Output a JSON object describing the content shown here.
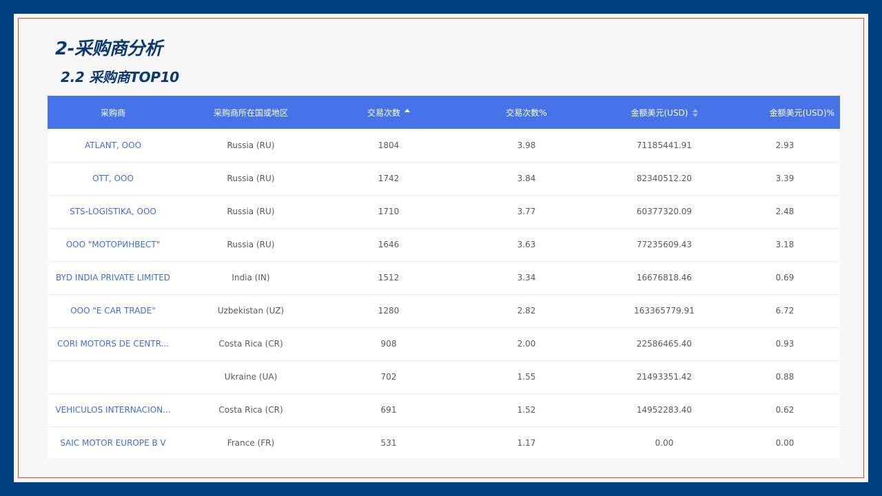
{
  "page": {
    "title": "2-采购商分析",
    "subtitle": "2.2 采购商TOP10"
  },
  "table": {
    "headers": [
      "采购商",
      "采购商所在国或地区",
      "交易次数",
      "交易次数%",
      "金额美元(USD)",
      "金额美元(USD)%"
    ],
    "rows": [
      [
        "ATLANT, OOO",
        "Russia (RU)",
        "1804",
        "3.98",
        "71185441.91",
        "2.93"
      ],
      [
        "OTT, OOO",
        "Russia (RU)",
        "1742",
        "3.84",
        "82340512.20",
        "3.39"
      ],
      [
        "STS-LOGISTIKA, OOO",
        "Russia (RU)",
        "1710",
        "3.77",
        "60377320.09",
        "2.48"
      ],
      [
        "OOO \"МОТОРИНВЕСТ\"",
        "Russia (RU)",
        "1646",
        "3.63",
        "77235609.43",
        "3.18"
      ],
      [
        "BYD INDIA PRIVATE LIMITED",
        "India (IN)",
        "1512",
        "3.34",
        "16676818.46",
        "0.69"
      ],
      [
        "OOO \"E CAR TRADE\"",
        "Uzbekistan (UZ)",
        "1280",
        "2.82",
        "163365779.91",
        "6.72"
      ],
      [
        "CORI MOTORS DE CENTR...",
        "Costa Rica (CR)",
        "908",
        "2.00",
        "22586465.40",
        "0.93"
      ],
      [
        "",
        "Ukraine (UA)",
        "702",
        "1.55",
        "21493351.42",
        "0.88"
      ],
      [
        "VEHICULOS INTERNACION...",
        "Costa Rica (CR)",
        "691",
        "1.52",
        "14952283.40",
        "0.62"
      ],
      [
        "SAIC MOTOR EUROPE B V",
        "France (FR)",
        "531",
        "1.17",
        "0.00",
        "0.00"
      ]
    ]
  },
  "colors": {
    "frame": "#014182",
    "header_bg": "#4673e8",
    "title": "#0b3a70",
    "link": "#3d6fd9",
    "border_accent": "#c9502e"
  },
  "icons": {
    "sort_trade_count": "sort-ascending-icon",
    "sort_amount": "sort-icon"
  }
}
